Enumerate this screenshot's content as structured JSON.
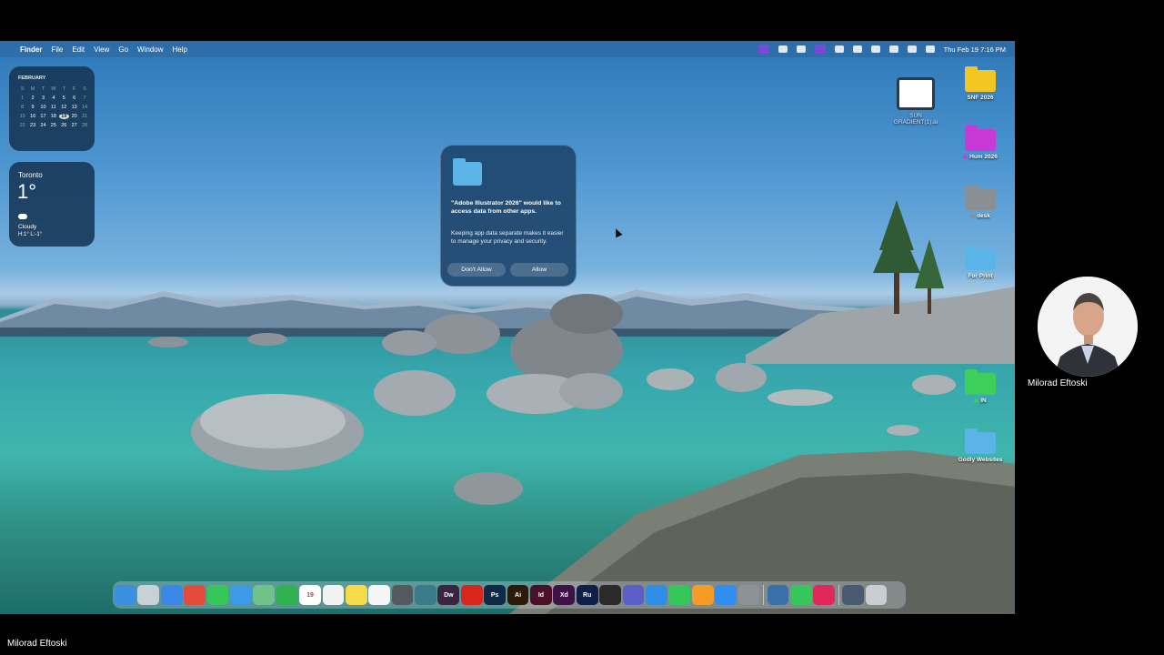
{
  "menubar": {
    "items": [
      "Finder",
      "File",
      "Edit",
      "View",
      "Go",
      "Window",
      "Help"
    ],
    "clock": "Thu Feb 19  7:16 PM"
  },
  "calendar": {
    "month": "FEBRUARY",
    "weekdays": [
      "S",
      "M",
      "T",
      "W",
      "T",
      "F",
      "S"
    ],
    "days": [
      "1",
      "2",
      "3",
      "4",
      "5",
      "6",
      "7",
      "8",
      "9",
      "10",
      "11",
      "12",
      "13",
      "14",
      "15",
      "16",
      "17",
      "18",
      "19",
      "20",
      "21",
      "22",
      "23",
      "24",
      "25",
      "26",
      "27",
      "28"
    ],
    "today": "19"
  },
  "weather": {
    "city": "Toronto",
    "temp": "1°",
    "condition": "Cloudy",
    "hilo": "H:1° L:-1°"
  },
  "dialog": {
    "title": "\"Adobe Illustrator 2026\" would like to access data from other apps.",
    "body": "Keeping app data separate makes it easier to manage your privacy and security.",
    "dont_allow": "Don't Allow",
    "allow": "Allow"
  },
  "desktop_icons": [
    {
      "label": "SUN GRADIENT(1).ai"
    },
    {
      "label": "SNF 2026",
      "color": "#f3c623"
    },
    {
      "label": "Hum 2026",
      "color": "#c83ad6",
      "tag": "#b04ad8"
    },
    {
      "label": "desk",
      "color": "#8a8f96",
      "tag": "#8a8f96"
    },
    {
      "label": "For Print",
      "color": "#5ab4e8"
    },
    {
      "label": "IN",
      "color": "#3ccf5a",
      "tag": "#3ccf5a"
    },
    {
      "label": "Godly Websites",
      "color": "#5ab4e8"
    }
  ],
  "dock": {
    "apps": [
      {
        "name": "finder",
        "color": "#3b8fe0",
        "text": ""
      },
      {
        "name": "launchpad",
        "color": "#c9d0d8",
        "text": ""
      },
      {
        "name": "safari",
        "color": "#3a87e6",
        "text": ""
      },
      {
        "name": "chrome",
        "color": "#e44b3a",
        "text": ""
      },
      {
        "name": "messages",
        "color": "#36c759",
        "text": ""
      },
      {
        "name": "mail",
        "color": "#3c9ae8",
        "text": ""
      },
      {
        "name": "maps",
        "color": "#6fc28a",
        "text": ""
      },
      {
        "name": "facetime",
        "color": "#2fb24f",
        "text": ""
      },
      {
        "name": "calendar",
        "color": "#ffffff",
        "text": "19"
      },
      {
        "name": "reminders",
        "color": "#f2f2f2",
        "text": ""
      },
      {
        "name": "notes",
        "color": "#f7d94a",
        "text": ""
      },
      {
        "name": "freeform",
        "color": "#f5f5f5",
        "text": ""
      },
      {
        "name": "calculator",
        "color": "#555a60",
        "text": ""
      },
      {
        "name": "photoshop-express",
        "color": "#3b7b8a",
        "text": ""
      },
      {
        "name": "dreamweaver",
        "color": "#3a2440",
        "text": "Dw"
      },
      {
        "name": "acrobat",
        "color": "#d9261c",
        "text": ""
      },
      {
        "name": "photoshop",
        "color": "#0f2a45",
        "text": "Ps"
      },
      {
        "name": "illustrator",
        "color": "#2b1a05",
        "text": "Ai"
      },
      {
        "name": "indesign",
        "color": "#4a1028",
        "text": "Id"
      },
      {
        "name": "xd",
        "color": "#3d1346",
        "text": "Xd"
      },
      {
        "name": "rush",
        "color": "#101f4a",
        "text": "Ru"
      },
      {
        "name": "figma",
        "color": "#2a2a2a",
        "text": ""
      },
      {
        "name": "teams",
        "color": "#5b5fc7",
        "text": ""
      },
      {
        "name": "keynote",
        "color": "#2f8fe6",
        "text": ""
      },
      {
        "name": "numbers",
        "color": "#34c759",
        "text": ""
      },
      {
        "name": "pages",
        "color": "#f59b27",
        "text": ""
      },
      {
        "name": "app-store",
        "color": "#2f8ef0",
        "text": ""
      },
      {
        "name": "system-settings",
        "color": "#8e9196",
        "text": ""
      },
      {
        "name": "finder-alt",
        "color": "#3b6fa8",
        "text": ""
      },
      {
        "name": "phone",
        "color": "#34c759",
        "text": ""
      },
      {
        "name": "creative-cloud",
        "color": "#e0285c",
        "text": ""
      },
      {
        "name": "downloads",
        "color": "#4a5a70",
        "text": ""
      },
      {
        "name": "trash",
        "color": "#c8cdd2",
        "text": ""
      }
    ]
  },
  "participant": {
    "name": "Milorad Eftoski"
  },
  "footer": {
    "name": "Milorad Eftoski"
  }
}
